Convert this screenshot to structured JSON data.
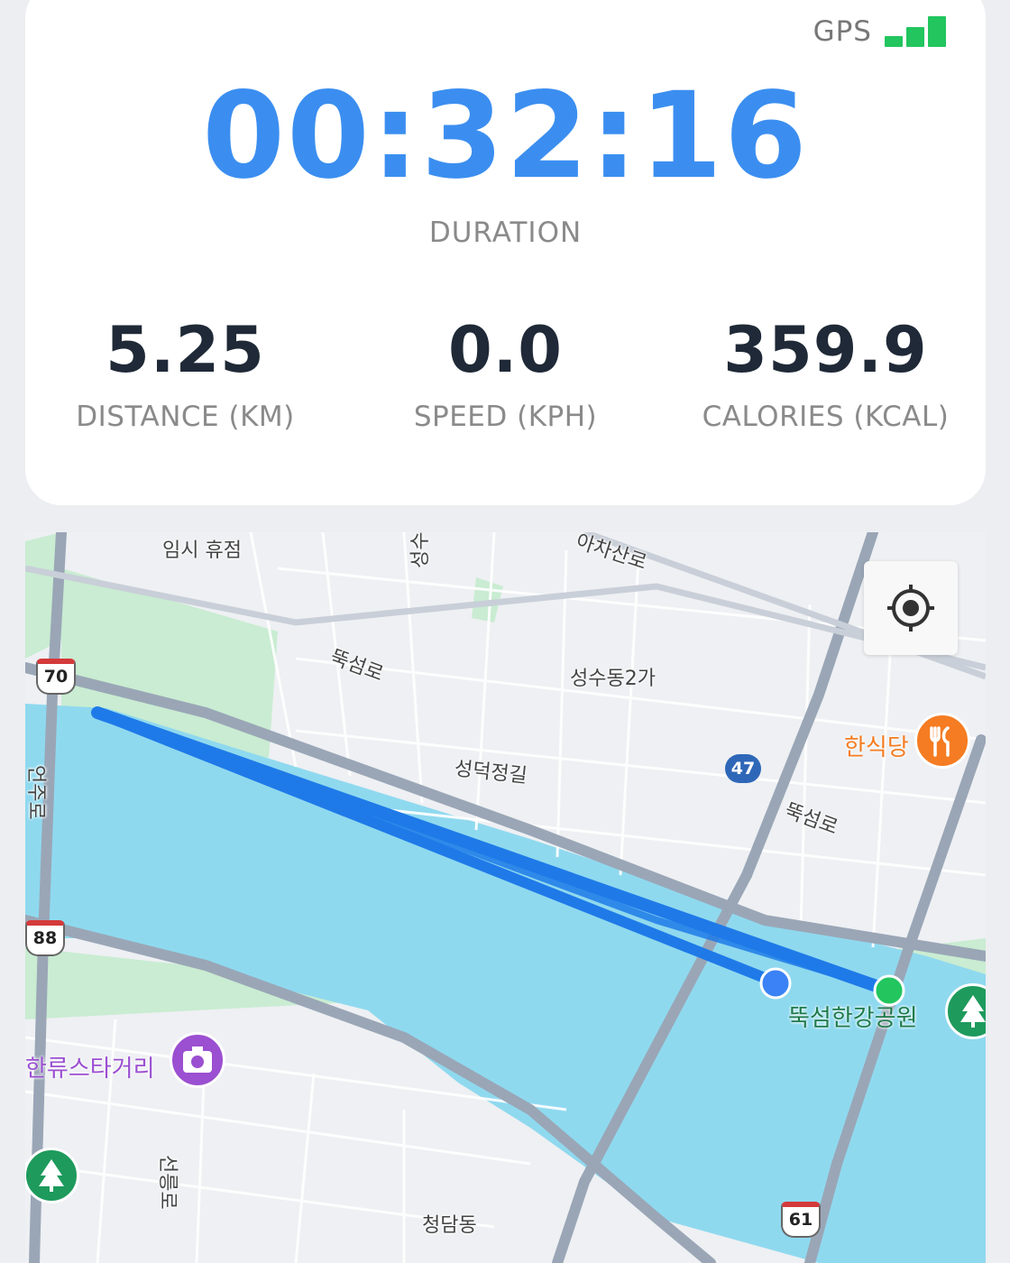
{
  "gps": {
    "label": "GPS",
    "signal_bars": 3,
    "color": "#22c55e"
  },
  "duration": {
    "value": "00:32:16",
    "label": "DURATION"
  },
  "stats": [
    {
      "value": "5.25",
      "label": "DISTANCE (KM)"
    },
    {
      "value": "0.0",
      "label": "SPEED (KPH)"
    },
    {
      "value": "359.9",
      "label": "CALORIES (KCAL)"
    }
  ],
  "map": {
    "labels": {
      "rest_area": "임시 휴점",
      "seongsu_road": "성수일로",
      "achasan": "아차산로",
      "ttukseom_ro_1": "뚝섬로",
      "seongsu_2ga": "성수동2가",
      "seongdeok": "성덕정길",
      "ttukseom_ro_2": "뚝섬로",
      "hansikdang": "한식당",
      "eonju": "언주로",
      "park": "뚝섬한강공원",
      "hallyu": "한류스타거리",
      "seolleung": "선릉로",
      "cheongdam": "청담동"
    },
    "route_shields": {
      "r70": "70",
      "r88": "88",
      "r61": "61",
      "r47": "47"
    },
    "colors": {
      "river": "#8fd9ef",
      "route": "#1f7ae8",
      "start_marker": "#22c55e",
      "end_marker": "#3b82f6",
      "park": "#c9ecd2",
      "restaurant": "#f57c22",
      "attraction": "#9b4fd1",
      "park_pin": "#1e9a5c"
    },
    "icons": [
      "my-location-icon",
      "restaurant-icon",
      "camera-icon",
      "tree-icon"
    ]
  }
}
